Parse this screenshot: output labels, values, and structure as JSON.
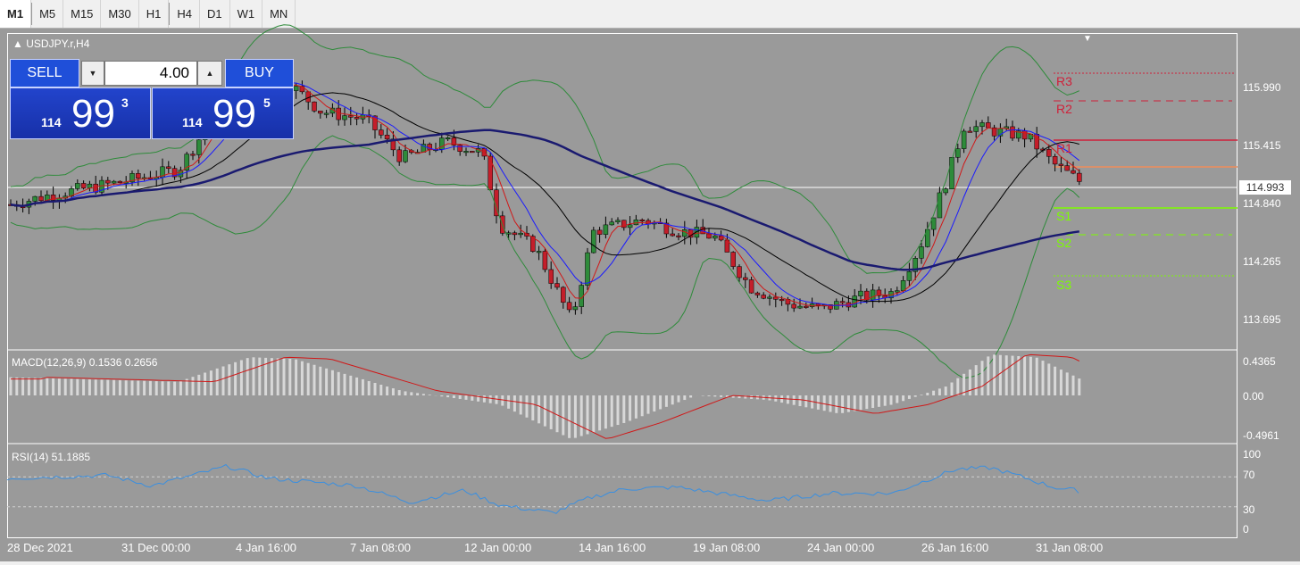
{
  "timeframes": [
    {
      "label": "M1",
      "active": true
    },
    {
      "label": "M5",
      "active": false
    },
    {
      "label": "M15",
      "active": false
    },
    {
      "label": "M30",
      "active": false
    },
    {
      "label": "H1",
      "active": false
    },
    {
      "label": "H4",
      "active": false
    },
    {
      "label": "D1",
      "active": false
    },
    {
      "label": "W1",
      "active": false
    },
    {
      "label": "MN",
      "active": false
    }
  ],
  "chart": {
    "title": "USDJPY.r,H4",
    "current_price": "114.993"
  },
  "trade_panel": {
    "sell_label": "SELL",
    "buy_label": "BUY",
    "lot_value": "4.00",
    "sell_big": "114",
    "sell_pips": "99",
    "sell_sup": "3",
    "buy_big": "114",
    "buy_pips": "99",
    "buy_sup": "5"
  },
  "price_axis": [
    "115.990",
    "115.415",
    "114.840",
    "114.265",
    "113.695"
  ],
  "levels": [
    {
      "label": "R3",
      "color": "#d0203a"
    },
    {
      "label": "R2",
      "color": "#d0203a"
    },
    {
      "label": "R1",
      "color": "#d0203a"
    },
    {
      "label": "S1",
      "color": "#7cfc00"
    },
    {
      "label": "S2",
      "color": "#7cfc00"
    },
    {
      "label": "S3",
      "color": "#7cfc00"
    }
  ],
  "macd": {
    "label": "MACD(12,26,9) 0.1536 0.2656",
    "axis": [
      "0.4365",
      "0.00",
      "-0.4961"
    ]
  },
  "rsi": {
    "label": "RSI(14) 51.1885",
    "axis": [
      "100",
      "70",
      "30",
      "0"
    ]
  },
  "dates": [
    "28 Dec 2021",
    "31 Dec 00:00",
    "4 Jan 16:00",
    "7 Jan 08:00",
    "12 Jan 00:00",
    "14 Jan 16:00",
    "19 Jan 08:00",
    "24 Jan 00:00",
    "26 Jan 16:00",
    "31 Jan 08:00"
  ],
  "colors": {
    "background": "#9a9a9a",
    "bull": "#2e8b3a",
    "bear": "#c41e2a",
    "ma_fast": "#d01818",
    "ma_mid": "#1a1aff",
    "ma_slow": "#000000",
    "ma_long": "#1a1a70",
    "bollinger": "#2e8b3a",
    "macd_signal": "#d01818",
    "rsi_line": "#3a8fe0"
  },
  "chart_data": {
    "type": "line",
    "x": [
      "28 Dec 2021",
      "31 Dec 00:00",
      "4 Jan 16:00",
      "7 Jan 08:00",
      "12 Jan 00:00",
      "14 Jan 16:00",
      "19 Jan 08:00",
      "24 Jan 00:00",
      "26 Jan 16:00",
      "31 Jan 08:00"
    ],
    "series": [
      {
        "name": "",
        "values": [
          114.82,
          115.05,
          115.92,
          115.62,
          114.3,
          114.52,
          114.35,
          113.87,
          115.42,
          114.99
        ]
      }
    ],
    "ylim": [
      113.5,
      116.3
    ]
  }
}
